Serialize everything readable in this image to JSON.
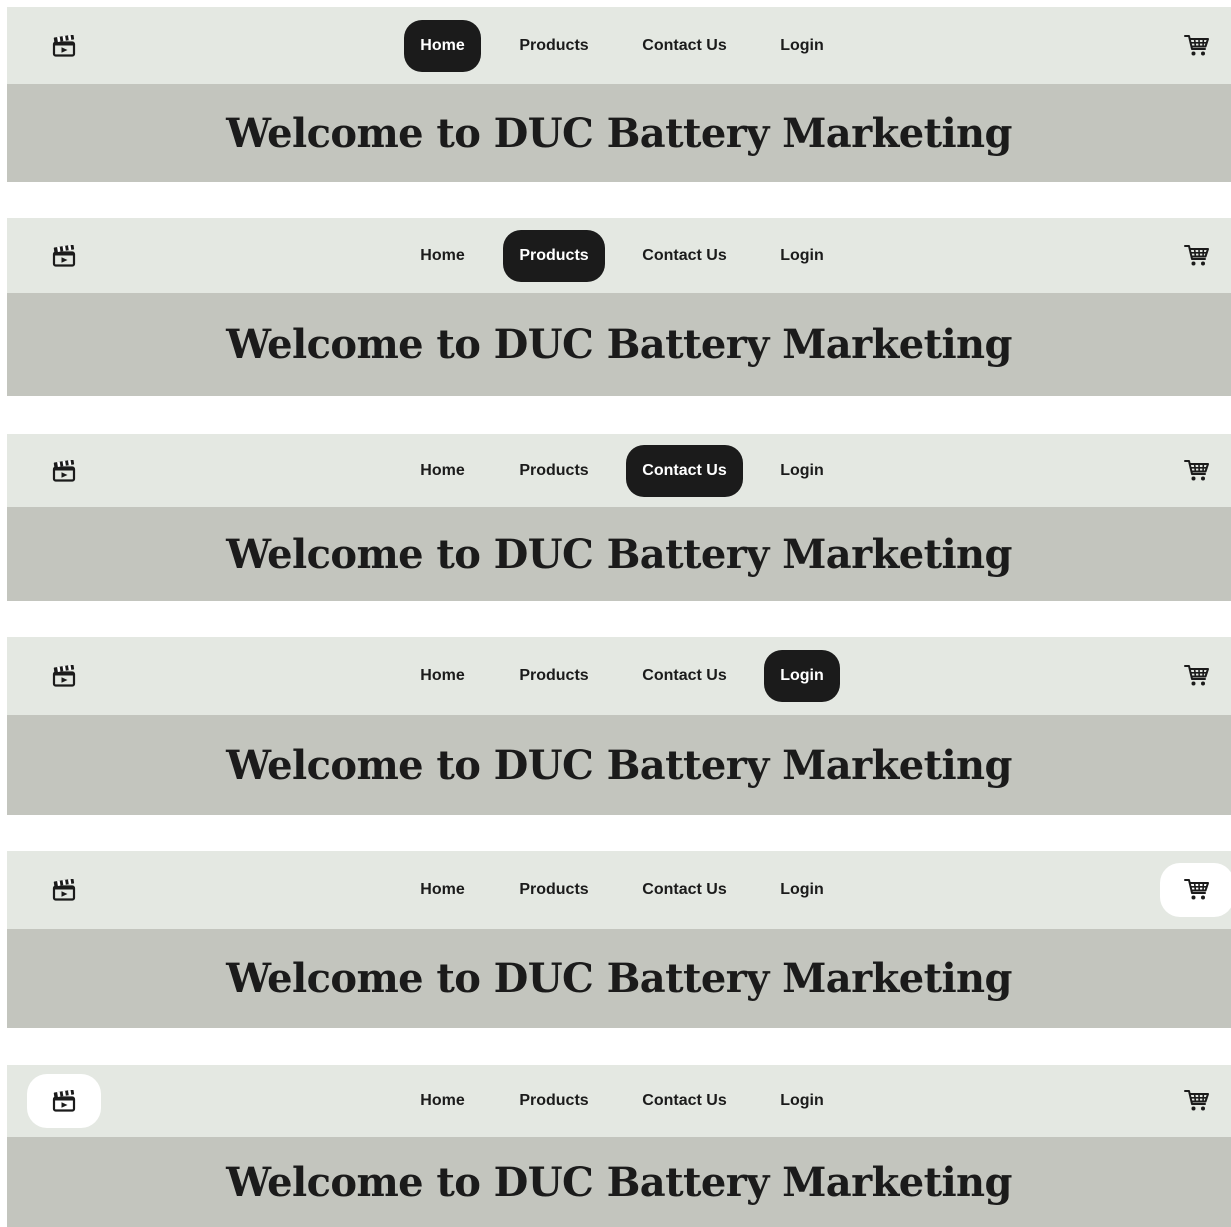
{
  "site": {
    "hero_title": "Welcome to DUC Battery Marketing",
    "nav": {
      "home": "Home",
      "products": "Products",
      "contact": "Contact Us",
      "login": "Login"
    },
    "icons": {
      "logo": "film-clapperboard-icon",
      "cart": "shopping-cart-icon"
    }
  },
  "states": [
    {
      "active": "home"
    },
    {
      "active": "products"
    },
    {
      "active": "contact"
    },
    {
      "active": "login"
    },
    {
      "active": "cart"
    },
    {
      "active": "logo"
    }
  ],
  "colors": {
    "navbar_bg": "#e4e8e2",
    "hero_bg": "#c3c5be",
    "active_pill": "#1b1b1b",
    "active_icon_bg": "#ffffff",
    "text": "#1b1b1b"
  }
}
